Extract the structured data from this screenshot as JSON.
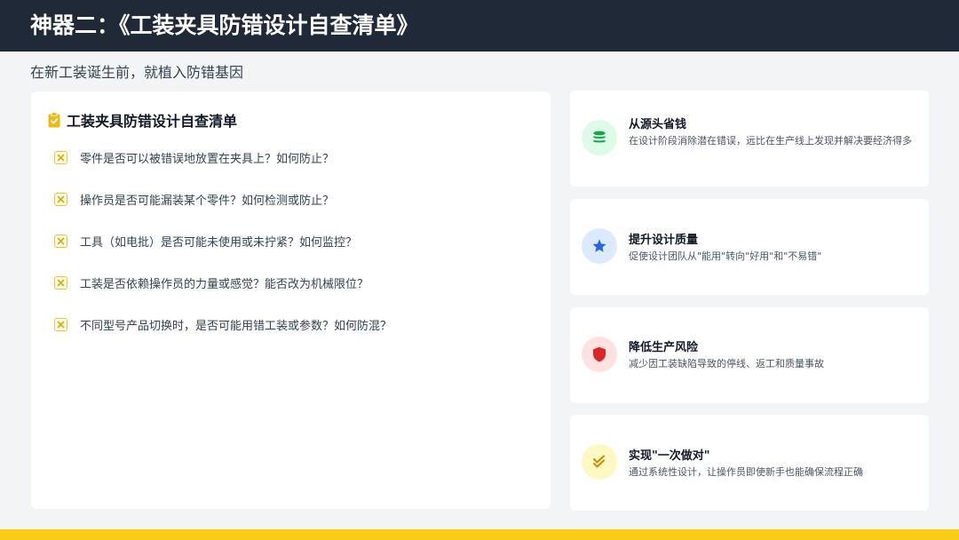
{
  "header": {
    "title": "神器二：《工装夹具防错设计自查清单》"
  },
  "subtitle": "在新工装诞生前，就植入防错基因",
  "checklist": {
    "title": "工装夹具防错设计自查清单",
    "items": [
      "零件是否可以被错误地放置在夹具上？如何防止？",
      "操作员是否可能漏装某个零件？如何检测或防止？",
      "工具（如电批）是否可能未使用或未拧紧？如何监控？",
      "工装是否依赖操作员的力量或感觉？能否改为机械限位？",
      "不同型号产品切换时，是否可能用错工装或参数？如何防混？"
    ]
  },
  "benefits": [
    {
      "icon": "coins-icon",
      "title": "从源头省钱",
      "desc": "在设计阶段消除潜在错误，远比在生产线上发现并解决要经济得多",
      "icon_bg": "#dcfce7",
      "icon_color": "#16a34a"
    },
    {
      "icon": "star-icon",
      "title": "提升设计质量",
      "desc": "促使设计团队从\"能用\"转向\"好用\"和\"不易错\"",
      "icon_bg": "#dbeafe",
      "icon_color": "#2563eb"
    },
    {
      "icon": "shield-icon",
      "title": "降低生产风险",
      "desc": "减少因工装缺陷导致的停线、返工和质量事故",
      "icon_bg": "#fee2e2",
      "icon_color": "#dc2626"
    },
    {
      "icon": "double-check-icon",
      "title": "实现\"一次做对\"",
      "desc": "通过系统性设计，让操作员即使新手也能确保流程正确",
      "icon_bg": "#fef9c3",
      "icon_color": "#ca8a04"
    }
  ],
  "colors": {
    "header_bg": "#1f2937",
    "accent_yellow": "#facc15",
    "page_bg": "#f3f4f6"
  }
}
